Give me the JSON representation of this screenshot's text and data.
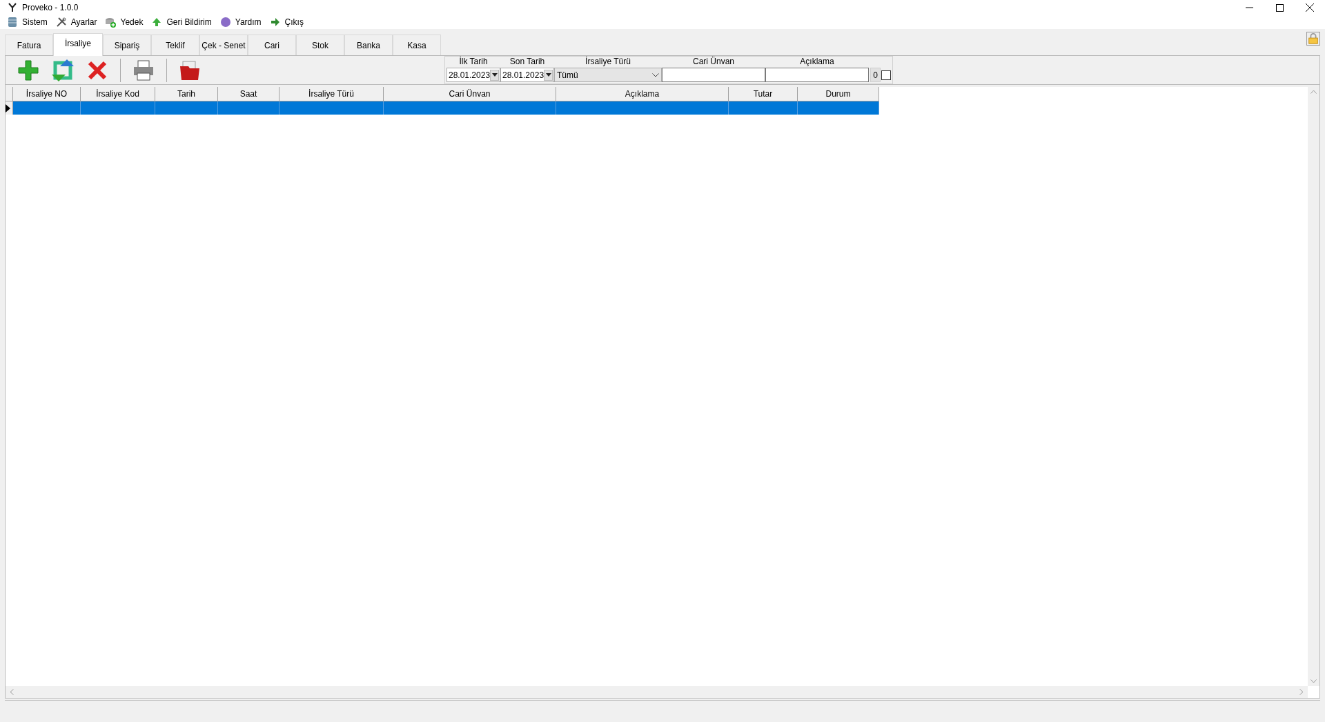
{
  "window": {
    "title": "Proveko - 1.0.0"
  },
  "menu": [
    {
      "label": "Sistem",
      "kind": "database"
    },
    {
      "label": "Ayarlar",
      "kind": "tools"
    },
    {
      "label": "Yedek",
      "kind": "backup"
    },
    {
      "label": "Geri Bildirim",
      "kind": "feedback"
    },
    {
      "label": "Yardım",
      "kind": "help"
    },
    {
      "label": "Çıkış",
      "kind": "exit"
    }
  ],
  "tabs": [
    {
      "label": "Fatura",
      "selected": false
    },
    {
      "label": "İrsaliye",
      "selected": true
    },
    {
      "label": "Sipariş",
      "selected": false
    },
    {
      "label": "Teklif",
      "selected": false
    },
    {
      "label": "Çek - Senet",
      "selected": false
    },
    {
      "label": "Cari",
      "selected": false
    },
    {
      "label": "Stok",
      "selected": false
    },
    {
      "label": "Banka",
      "selected": false
    },
    {
      "label": "Kasa",
      "selected": false
    }
  ],
  "toolbar": [
    {
      "kind": "add"
    },
    {
      "kind": "refresh"
    },
    {
      "kind": "delete"
    },
    {
      "kind": "separator"
    },
    {
      "kind": "print"
    },
    {
      "kind": "separator"
    },
    {
      "kind": "folder"
    }
  ],
  "filters": [
    {
      "kind": "date",
      "label": "İlk Tarih",
      "value": "28.01.2023"
    },
    {
      "kind": "date",
      "label": "Son Tarih",
      "value": "28.01.2023"
    },
    {
      "kind": "combo",
      "label": "İrsaliye Türü",
      "value": "Tümü"
    },
    {
      "kind": "text",
      "label": "Cari Ünvan"
    },
    {
      "kind": "text",
      "label": "Açıklama"
    }
  ],
  "count": "0",
  "checkbox": {
    "checked": false
  },
  "grid": {
    "columns": [
      "İrsaliye NO",
      "İrsaliye Kod",
      "Tarih",
      "Saat",
      "İrsaliye Türü",
      "Cari Ünvan",
      "Açıklama",
      "Tutar",
      "Durum"
    ],
    "rows": [
      {
        "selected": true
      }
    ]
  }
}
